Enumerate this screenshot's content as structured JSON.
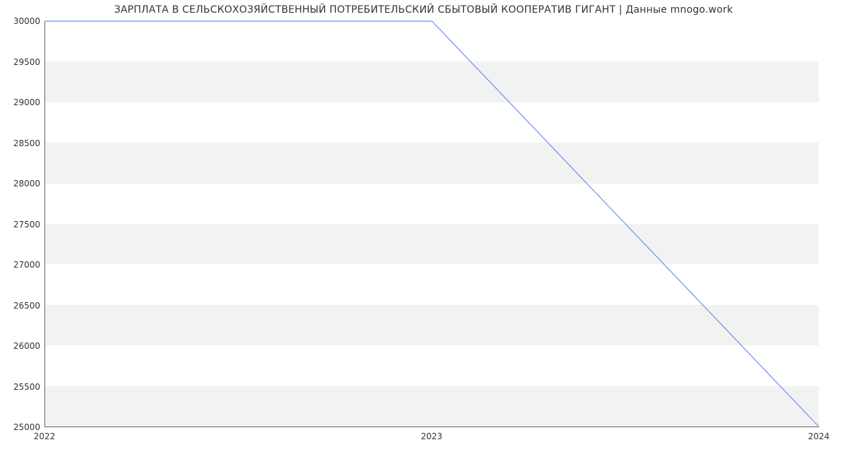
{
  "chart_data": {
    "type": "line",
    "title": "ЗАРПЛАТА В СЕЛЬСКОХОЗЯЙСТВЕННЫЙ ПОТРЕБИТЕЛЬСКИЙ СБЫТОВЫЙ КООПЕРАТИВ ГИГАНТ | Данные mnogo.work",
    "x": [
      2022,
      2023,
      2024
    ],
    "values": [
      30000,
      30000,
      25000
    ],
    "xlabel": "",
    "ylabel": "",
    "x_ticks": [
      "2022",
      "2023",
      "2024"
    ],
    "y_ticks": [
      "25000",
      "25500",
      "26000",
      "26500",
      "27000",
      "27500",
      "28000",
      "28500",
      "29000",
      "29500",
      "30000"
    ],
    "xlim": [
      2022,
      2024
    ],
    "ylim": [
      25000,
      30000
    ],
    "line_color": "#6495ed"
  }
}
